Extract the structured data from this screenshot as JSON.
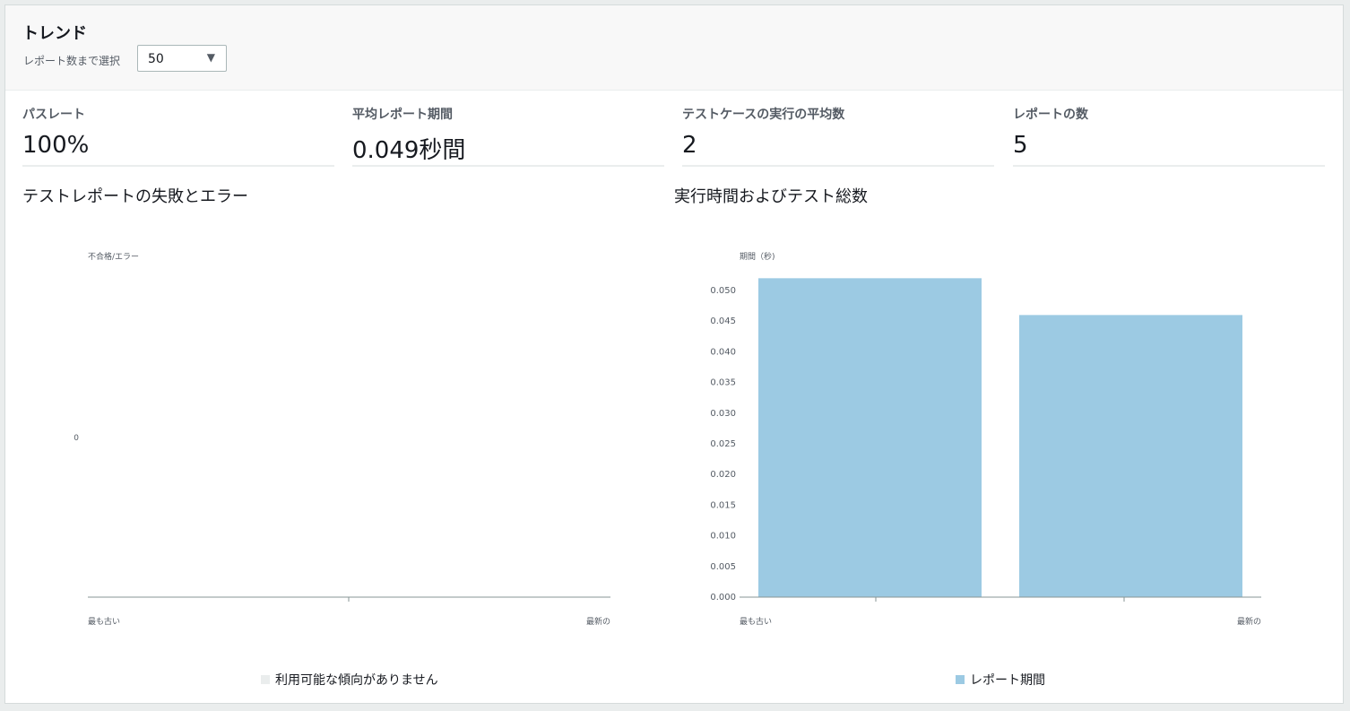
{
  "header": {
    "title": "トレンド",
    "select_label": "レポート数まで選択",
    "select_value": "50"
  },
  "metrics": [
    {
      "label": "パスレート",
      "value": "100%"
    },
    {
      "label": "平均レポート期間",
      "value": "0.049秒間"
    },
    {
      "label": "テストケースの実行の平均数",
      "value": "2"
    },
    {
      "label": "レポートの数",
      "value": "5"
    }
  ],
  "icons": {
    "select_caret": "caret-down-icon"
  },
  "colors": {
    "bar": "#9ccae3",
    "empty_legend": "#eaeded",
    "axis": "#879596"
  },
  "chart_data": [
    {
      "type": "bar",
      "title": "テストレポートの失敗とエラー",
      "ylabel": "不合格/エラー",
      "y_ticks": [
        "0"
      ],
      "x_labels": [
        "最も古い",
        "最新の"
      ],
      "categories": [],
      "series": [],
      "legend": [
        "利用可能な傾向がありません"
      ],
      "legend_position": "bottom"
    },
    {
      "type": "bar",
      "title": "実行時間およびテスト総数",
      "ylabel": "期間（秒)",
      "ylim": [
        0,
        0.05
      ],
      "y_ticks": [
        "0.000",
        "0.005",
        "0.010",
        "0.015",
        "0.020",
        "0.025",
        "0.030",
        "0.035",
        "0.040",
        "0.045",
        "0.050"
      ],
      "x_labels": [
        "最も古い",
        "最新の"
      ],
      "series": [
        {
          "name": "レポート期間",
          "values": [
            0.052,
            0.046
          ]
        }
      ],
      "legend": [
        "レポート期間"
      ],
      "legend_position": "bottom"
    }
  ]
}
